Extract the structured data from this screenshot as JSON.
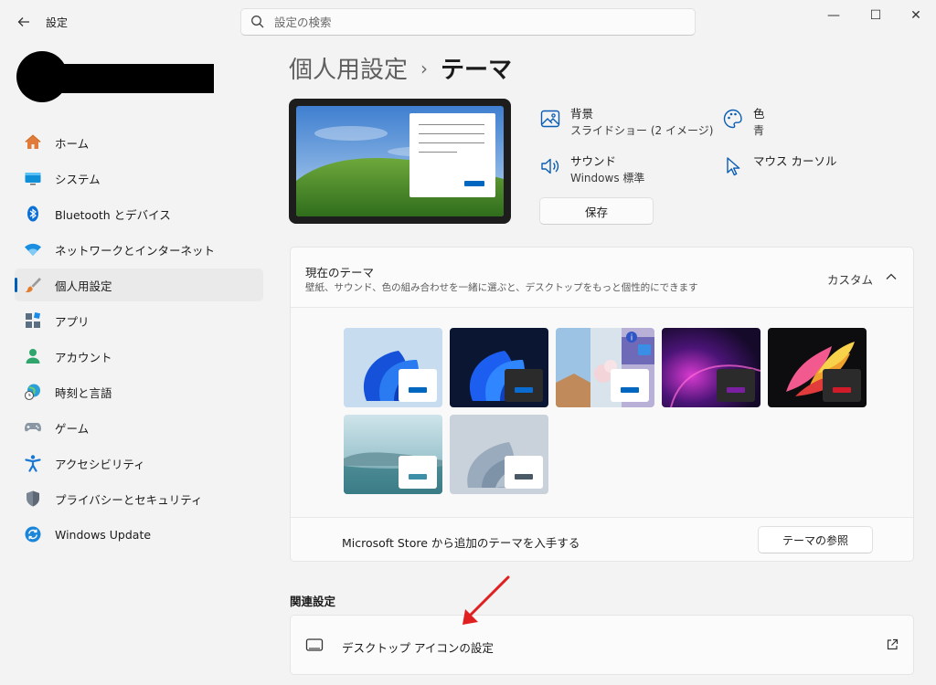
{
  "window": {
    "title": "設定",
    "controls": {
      "minimize": "—",
      "maximize": "☐",
      "close": "✕"
    }
  },
  "search": {
    "placeholder": "設定の検索"
  },
  "sidebar": {
    "items": [
      {
        "label": "ホーム",
        "icon": "home-icon"
      },
      {
        "label": "システム",
        "icon": "system-icon"
      },
      {
        "label": "Bluetooth とデバイス",
        "icon": "bluetooth-icon"
      },
      {
        "label": "ネットワークとインターネット",
        "icon": "wifi-icon"
      },
      {
        "label": "個人用設定",
        "icon": "brush-icon",
        "active": true
      },
      {
        "label": "アプリ",
        "icon": "apps-icon"
      },
      {
        "label": "アカウント",
        "icon": "account-icon"
      },
      {
        "label": "時刻と言語",
        "icon": "globe-clock-icon"
      },
      {
        "label": "ゲーム",
        "icon": "gamepad-icon"
      },
      {
        "label": "アクセシビリティ",
        "icon": "accessibility-icon"
      },
      {
        "label": "プライバシーとセキュリティ",
        "icon": "shield-icon"
      },
      {
        "label": "Windows Update",
        "icon": "update-icon"
      }
    ]
  },
  "breadcrumb": {
    "parent": "個人用設定",
    "separator": "›",
    "current": "テーマ"
  },
  "quick_settings": {
    "background": {
      "title": "背景",
      "value": "スライドショー (2 イメージ)"
    },
    "color": {
      "title": "色",
      "value": "青"
    },
    "sound": {
      "title": "サウンド",
      "value": "Windows 標準"
    },
    "cursor": {
      "title": "マウス カーソル"
    },
    "save_label": "保存"
  },
  "current_theme": {
    "title": "現在のテーマ",
    "description": "壁紙、サウンド、色の組み合わせを一緒に選ぶと、デスクトップをもっと個性的にできます",
    "value": "カスタム",
    "store_text": "Microsoft Store から追加のテーマを入手する",
    "browse_label": "テーマの参照",
    "themes": [
      {
        "bar_color": "#0067c0"
      },
      {
        "bar_color": "#0a6cd0"
      },
      {
        "bar_color": "#0067c0"
      },
      {
        "bar_color": "#7a1fa2"
      },
      {
        "bar_color": "#d11a2a"
      },
      {
        "bar_color": "#3d8fa8"
      },
      {
        "bar_color": "#4a5966"
      }
    ]
  },
  "related": {
    "heading": "関連設定",
    "desktop_icons_label": "デスクトップ アイコンの設定"
  },
  "colors": {
    "accent": "#005fb8",
    "annotation_arrow": "#e02020"
  }
}
